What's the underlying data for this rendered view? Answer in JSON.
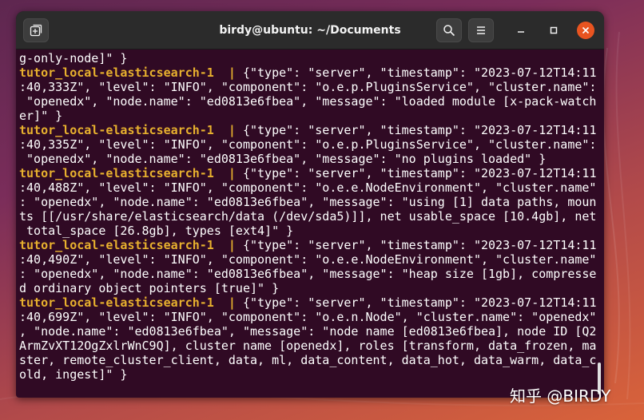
{
  "window": {
    "title": "birdy@ubuntu: ~/Documents"
  },
  "icons": {
    "new_tab": "new-tab-icon",
    "search": "search-icon",
    "menu": "hamburger-menu-icon",
    "minimize": "minimize-icon",
    "maximize": "maximize-icon",
    "close": "close-icon"
  },
  "colors": {
    "terminal_bg": "#300a24",
    "service_name": "#e8b12e",
    "text": "#ffffff",
    "close_button": "#e95420"
  },
  "terminal": {
    "lines": [
      [
        {
          "t": "g-only-node]\" }",
          "c": "txt"
        }
      ],
      [
        {
          "t": "tutor_local-elasticsearch-1",
          "c": "name"
        },
        {
          "t": "  | ",
          "c": "sep"
        },
        {
          "t": "{\"type\": \"server\", \"timestamp\": \"2023-07-12T14:11",
          "c": "txt"
        }
      ],
      [
        {
          "t": ":40,333Z\", \"level\": \"INFO\", \"component\": \"o.e.p.PluginsService\", \"cluster.name\":",
          "c": "txt"
        }
      ],
      [
        {
          "t": " \"openedx\", \"node.name\": \"ed0813e6fbea\", \"message\": \"loaded module [x-pack-watch",
          "c": "txt"
        }
      ],
      [
        {
          "t": "er]\" }",
          "c": "txt"
        }
      ],
      [
        {
          "t": "tutor_local-elasticsearch-1",
          "c": "name"
        },
        {
          "t": "  | ",
          "c": "sep"
        },
        {
          "t": "{\"type\": \"server\", \"timestamp\": \"2023-07-12T14:11",
          "c": "txt"
        }
      ],
      [
        {
          "t": ":40,335Z\", \"level\": \"INFO\", \"component\": \"o.e.p.PluginsService\", \"cluster.name\":",
          "c": "txt"
        }
      ],
      [
        {
          "t": " \"openedx\", \"node.name\": \"ed0813e6fbea\", \"message\": \"no plugins loaded\" }",
          "c": "txt"
        }
      ],
      [
        {
          "t": "tutor_local-elasticsearch-1",
          "c": "name"
        },
        {
          "t": "  | ",
          "c": "sep"
        },
        {
          "t": "{\"type\": \"server\", \"timestamp\": \"2023-07-12T14:11",
          "c": "txt"
        }
      ],
      [
        {
          "t": ":40,488Z\", \"level\": \"INFO\", \"component\": \"o.e.e.NodeEnvironment\", \"cluster.name\"",
          "c": "txt"
        }
      ],
      [
        {
          "t": ": \"openedx\", \"node.name\": \"ed0813e6fbea\", \"message\": \"using [1] data paths, moun",
          "c": "txt"
        }
      ],
      [
        {
          "t": "ts [[/usr/share/elasticsearch/data (/dev/sda5)]], net usable_space [10.4gb], net",
          "c": "txt"
        }
      ],
      [
        {
          "t": " total_space [26.8gb], types [ext4]\" }",
          "c": "txt"
        }
      ],
      [
        {
          "t": "tutor_local-elasticsearch-1",
          "c": "name"
        },
        {
          "t": "  | ",
          "c": "sep"
        },
        {
          "t": "{\"type\": \"server\", \"timestamp\": \"2023-07-12T14:11",
          "c": "txt"
        }
      ],
      [
        {
          "t": ":40,490Z\", \"level\": \"INFO\", \"component\": \"o.e.e.NodeEnvironment\", \"cluster.name\"",
          "c": "txt"
        }
      ],
      [
        {
          "t": ": \"openedx\", \"node.name\": \"ed0813e6fbea\", \"message\": \"heap size [1gb], compresse",
          "c": "txt"
        }
      ],
      [
        {
          "t": "d ordinary object pointers [true]\" }",
          "c": "txt"
        }
      ],
      [
        {
          "t": "tutor_local-elasticsearch-1",
          "c": "name"
        },
        {
          "t": "  | ",
          "c": "sep"
        },
        {
          "t": "{\"type\": \"server\", \"timestamp\": \"2023-07-12T14:11",
          "c": "txt"
        }
      ],
      [
        {
          "t": ":40,699Z\", \"level\": \"INFO\", \"component\": \"o.e.n.Node\", \"cluster.name\": \"openedx\"",
          "c": "txt"
        }
      ],
      [
        {
          "t": ", \"node.name\": \"ed0813e6fbea\", \"message\": \"node name [ed0813e6fbea], node ID [Q2",
          "c": "txt"
        }
      ],
      [
        {
          "t": "ArmZvXT12OgZxlrWnC9Q], cluster name [openedx], roles [transform, data_frozen, ma",
          "c": "txt"
        }
      ],
      [
        {
          "t": "ster, remote_cluster_client, data, ml, data_content, data_hot, data_warm, data_c",
          "c": "txt"
        }
      ],
      [
        {
          "t": "old, ingest]\" }",
          "c": "txt"
        }
      ]
    ]
  },
  "watermark": {
    "text": "知乎 @BIRDY"
  }
}
